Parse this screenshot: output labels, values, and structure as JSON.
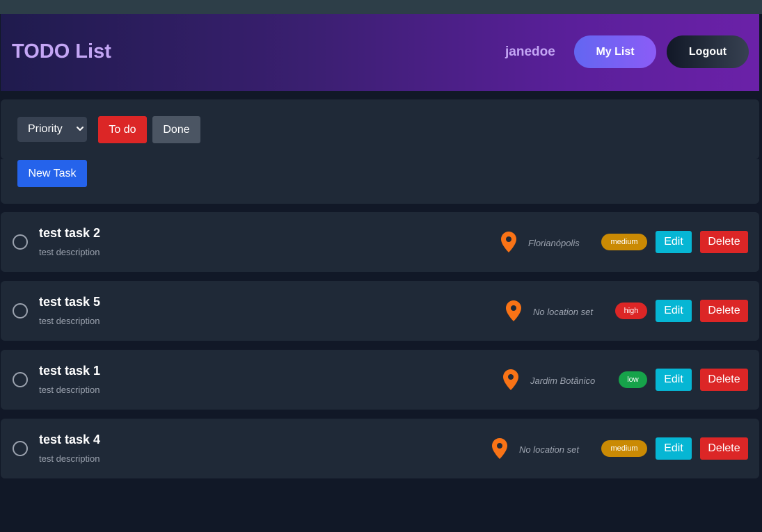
{
  "header": {
    "title": "TODO List",
    "username": "janedoe",
    "my_list_label": "My List",
    "logout_label": "Logout"
  },
  "filters": {
    "priority_selected": "Priority",
    "todo_label": "To do",
    "done_label": "Done",
    "new_task_label": "New Task"
  },
  "colors": {
    "todo_active": "#dc2626",
    "done_inactive": "#4b5563",
    "new_task": "#2563eb",
    "edit": "#06b6d4",
    "delete": "#dc2626",
    "pin": "#f97316",
    "priority_medium": "#ca8a04",
    "priority_high": "#dc2626",
    "priority_low": "#16a34a"
  },
  "icons": {
    "location": "map-pin-icon",
    "checkbox": "empty-circle-icon",
    "select": "chevron-down-icon"
  },
  "tasks": [
    {
      "title": "test task 2",
      "description": "test description",
      "location": "Florianópolis",
      "priority": "medium",
      "edit_label": "Edit",
      "delete_label": "Delete"
    },
    {
      "title": "test task 5",
      "description": "test description",
      "location": "No location set",
      "priority": "high",
      "edit_label": "Edit",
      "delete_label": "Delete"
    },
    {
      "title": "test task 1",
      "description": "test description",
      "location": "Jardim Botânico",
      "priority": "low",
      "edit_label": "Edit",
      "delete_label": "Delete"
    },
    {
      "title": "test task 4",
      "description": "test description",
      "location": "No location set",
      "priority": "medium",
      "edit_label": "Edit",
      "delete_label": "Delete"
    }
  ]
}
